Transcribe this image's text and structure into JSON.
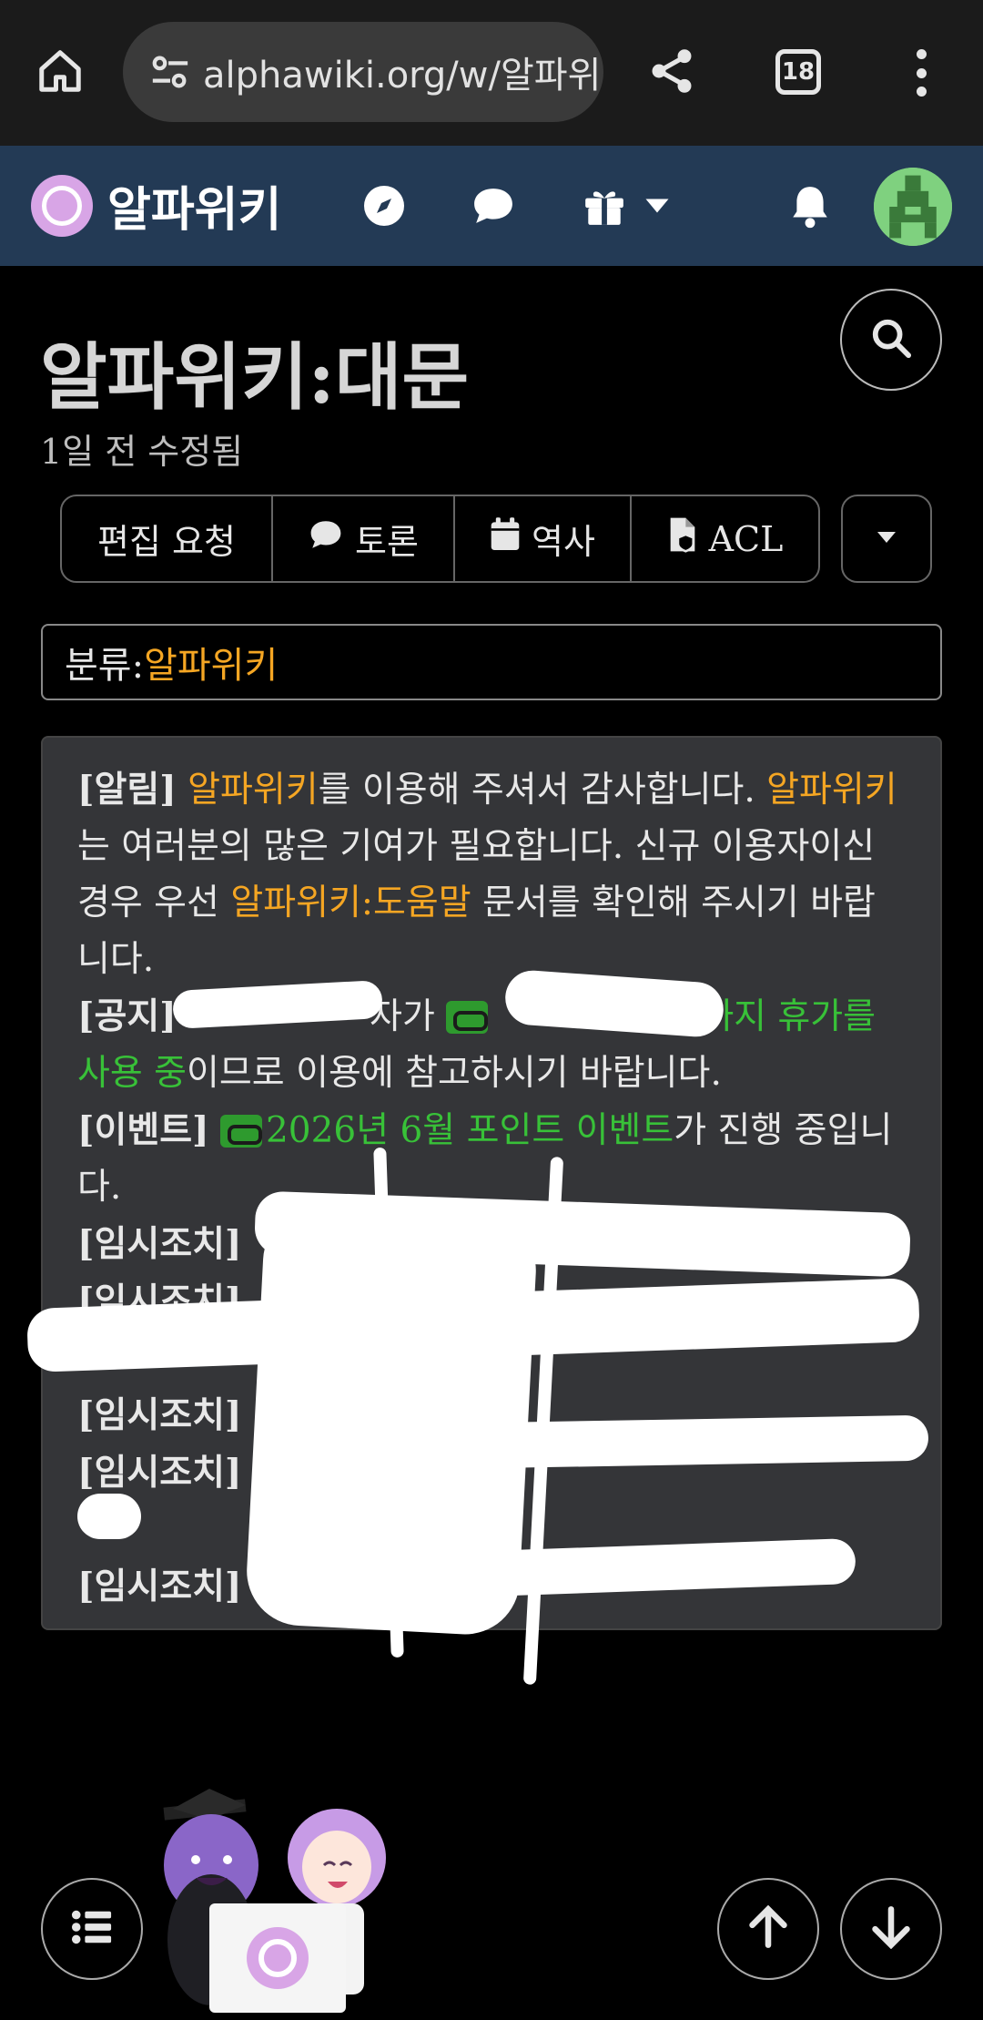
{
  "browser": {
    "url": "alphawiki.org/w/알파위",
    "tab_count": "18",
    "icons": [
      "home-icon",
      "tune-icon",
      "share-icon",
      "tabs-icon",
      "more-vert-icon"
    ]
  },
  "site": {
    "name": "알파위키",
    "brand_color": "#233a55",
    "logo_color": "#d8a5e6",
    "nav_icons": [
      "compass-icon",
      "chat-icon",
      "gift-icon",
      "bell-icon"
    ]
  },
  "page": {
    "title": "알파위키:대문",
    "modified": "1일 전 수정됨",
    "actions": {
      "edit_request": "편집 요청",
      "discussion": "토론",
      "history": "역사",
      "acl": "ACL"
    },
    "category_label": "분류:",
    "category_value": "알파위키"
  },
  "notices": {
    "alert_tag": "[알림]",
    "alert_link1": "알파위키",
    "alert_text1": "를 이용해 주셔서 감사합니다. ",
    "alert_link2": "알파위키",
    "alert_text2": "는 여러분의 많은 기여가 필요합니다. 신규 이용자이신 경우 우선 ",
    "alert_link3": "알파위키:도움말",
    "alert_text3": " 문서를 확인해 주시기 바랍니다.",
    "notice_tag": "[공지]",
    "notice_text_a": "자가",
    "notice_link_tail": "까지 휴가를 사용 중",
    "notice_text_b": "이므로 이용에 참고하시기 바랍니다.",
    "event_tag": "[이벤트]",
    "event_link": "2026년 6월 포인트 이벤트",
    "event_text": "가 진행 중입니다.",
    "temp_tag": "[임시조치]"
  }
}
